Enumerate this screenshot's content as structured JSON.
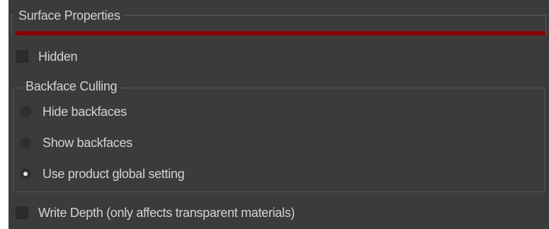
{
  "section": {
    "title": "Surface Properties",
    "accent_color": "#8b0000"
  },
  "hidden": {
    "label": "Hidden",
    "checked": false
  },
  "backface_culling": {
    "title": "Backface Culling",
    "options": [
      {
        "label": "Hide backfaces",
        "selected": false
      },
      {
        "label": "Show backfaces",
        "selected": false
      },
      {
        "label": "Use product global setting",
        "selected": true
      }
    ]
  },
  "write_depth": {
    "label": "Write Depth (only affects transparent materials)",
    "checked": false
  }
}
